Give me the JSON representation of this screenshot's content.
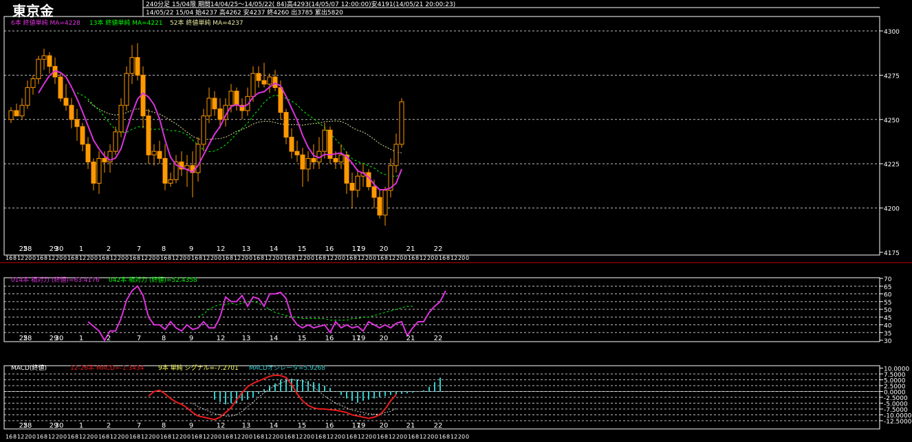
{
  "header": {
    "title": "東京金",
    "info_line1": "240分足  15/04限  期間14/04/25～14/05/22( 84)高4293(14/05/07 12:00:00)安4191(14/05/21 20:00:23)",
    "info_line2": "14/05/22 15/04  始4237 高4262 安4237 終4260 出3785 累出5820"
  },
  "colors": {
    "candle": "#ff9900",
    "ma6": "#dd33dd",
    "ma13": "#00ff00",
    "ma52": "#e6e6a0",
    "grid": "#ffffff",
    "frame": "#ffffff",
    "separator": "#cc0000",
    "macd_line": "#ee1c1c",
    "signal": "#ffffff",
    "histogram": "#33cccc"
  },
  "chart_data": [
    {
      "type": "candlestick",
      "legend": [
        {
          "label": "6本  終値単純  MA=4228",
          "color": "#dd33dd"
        },
        {
          "label": "13本  終値単純  MA=4221",
          "color": "#00ff00"
        },
        {
          "label": "52本  終値単純  MA=4237",
          "color": "#e6e6a0"
        }
      ],
      "y_ticks": [
        "4300",
        "4275",
        "4250",
        "4225",
        "4200",
        "4175"
      ],
      "ylim": [
        4175,
        4310
      ],
      "date_labels": [
        "28",
        "30",
        "1",
        "2",
        "7",
        "8",
        "9",
        "12",
        "13",
        "14",
        "15",
        "16",
        "19",
        "20",
        "21",
        "22"
      ],
      "date_labels_secondary": [
        "25",
        "29",
        "17"
      ],
      "hour_labels": [
        "16",
        "8",
        "12",
        "20",
        "0"
      ],
      "candles": [
        [
          4250,
          4257,
          4248,
          4255
        ],
        [
          4255,
          4259,
          4253,
          4252
        ],
        [
          4252,
          4262,
          4250,
          4258
        ],
        [
          4258,
          4272,
          4256,
          4268
        ],
        [
          4268,
          4275,
          4264,
          4273
        ],
        [
          4273,
          4286,
          4270,
          4284
        ],
        [
          4284,
          4290,
          4278,
          4286
        ],
        [
          4286,
          4288,
          4276,
          4280
        ],
        [
          4280,
          4285,
          4270,
          4274
        ],
        [
          4274,
          4276,
          4260,
          4262
        ],
        [
          4262,
          4270,
          4255,
          4258
        ],
        [
          4258,
          4262,
          4245,
          4250
        ],
        [
          4250,
          4256,
          4238,
          4246
        ],
        [
          4246,
          4248,
          4232,
          4236
        ],
        [
          4236,
          4240,
          4222,
          4226
        ],
        [
          4226,
          4228,
          4210,
          4214
        ],
        [
          4214,
          4232,
          4208,
          4228
        ],
        [
          4228,
          4232,
          4220,
          4226
        ],
        [
          4226,
          4236,
          4220,
          4232
        ],
        [
          4232,
          4246,
          4230,
          4243
        ],
        [
          4243,
          4262,
          4240,
          4258
        ],
        [
          4258,
          4280,
          4255,
          4276
        ],
        [
          4276,
          4292,
          4270,
          4285
        ],
        [
          4285,
          4293,
          4272,
          4275
        ],
        [
          4275,
          4280,
          4245,
          4252
        ],
        [
          4252,
          4256,
          4225,
          4230
        ],
        [
          4230,
          4236,
          4224,
          4232
        ],
        [
          4232,
          4238,
          4225,
          4228
        ],
        [
          4228,
          4236,
          4210,
          4214
        ],
        [
          4214,
          4220,
          4212,
          4216
        ],
        [
          4216,
          4230,
          4214,
          4226
        ],
        [
          4226,
          4232,
          4218,
          4222
        ],
        [
          4222,
          4230,
          4212,
          4224
        ],
        [
          4224,
          4232,
          4206,
          4220
        ],
        [
          4220,
          4240,
          4215,
          4236
        ],
        [
          4236,
          4256,
          4232,
          4252
        ],
        [
          4252,
          4268,
          4248,
          4262
        ],
        [
          4262,
          4266,
          4252,
          4256
        ],
        [
          4256,
          4262,
          4245,
          4250
        ],
        [
          4250,
          4262,
          4246,
          4258
        ],
        [
          4258,
          4270,
          4254,
          4266
        ],
        [
          4266,
          4268,
          4255,
          4258
        ],
        [
          4258,
          4262,
          4250,
          4255
        ],
        [
          4255,
          4268,
          4252,
          4263
        ],
        [
          4263,
          4280,
          4260,
          4276
        ],
        [
          4276,
          4280,
          4268,
          4272
        ],
        [
          4272,
          4282,
          4268,
          4270
        ],
        [
          4270,
          4276,
          4265,
          4274
        ],
        [
          4274,
          4278,
          4266,
          4268
        ],
        [
          4268,
          4272,
          4250,
          4254
        ],
        [
          4254,
          4256,
          4236,
          4240
        ],
        [
          4240,
          4245,
          4228,
          4232
        ],
        [
          4232,
          4238,
          4226,
          4230
        ],
        [
          4230,
          4234,
          4212,
          4222
        ],
        [
          4222,
          4232,
          4215,
          4228
        ],
        [
          4228,
          4236,
          4222,
          4226
        ],
        [
          4226,
          4240,
          4222,
          4232
        ],
        [
          4232,
          4248,
          4228,
          4244
        ],
        [
          4244,
          4246,
          4225,
          4228
        ],
        [
          4228,
          4232,
          4222,
          4226
        ],
        [
          4226,
          4236,
          4222,
          4230
        ],
        [
          4230,
          4232,
          4208,
          4214
        ],
        [
          4214,
          4220,
          4200,
          4210
        ],
        [
          4210,
          4222,
          4206,
          4218
        ],
        [
          4218,
          4225,
          4212,
          4220
        ],
        [
          4220,
          4222,
          4210,
          4212
        ],
        [
          4212,
          4216,
          4200,
          4206
        ],
        [
          4206,
          4210,
          4194,
          4196
        ],
        [
          4196,
          4212,
          4190,
          4210
        ],
        [
          4210,
          4228,
          4206,
          4224
        ],
        [
          4224,
          4242,
          4220,
          4236
        ],
        [
          4236,
          4262,
          4234,
          4260
        ]
      ]
    },
    {
      "type": "line",
      "legend": [
        {
          "label": "014本  相対力  (終値)=63.4176",
          "color": "#dd33dd"
        },
        {
          "label": "042本  相対力  (終値)=52.4358",
          "color": "#00ff00"
        }
      ],
      "y_ticks": [
        "70",
        "65",
        "60",
        "55",
        "50",
        "45",
        "40",
        "35",
        "30"
      ],
      "ylim": [
        30,
        70
      ],
      "rsi14_start_index": 14,
      "rsi14": [
        42,
        39,
        36,
        30,
        36,
        36,
        44,
        56,
        62,
        65,
        59,
        45,
        40,
        40,
        37,
        42,
        38,
        36,
        40,
        37,
        38,
        42,
        38,
        38,
        45,
        58,
        55,
        55,
        59,
        52,
        58,
        57,
        52,
        60,
        60,
        61,
        57,
        45,
        40,
        38,
        40,
        38,
        39,
        40,
        35,
        42,
        38,
        40,
        38,
        39,
        36,
        42,
        40,
        38,
        40,
        38,
        41,
        42,
        33,
        38,
        42,
        42,
        48,
        52,
        55,
        62
      ],
      "rsi42_start_index": 34,
      "rsi42": [
        45,
        47,
        50,
        52,
        53,
        53,
        54,
        53,
        54,
        55,
        55,
        54,
        52,
        50,
        48,
        47,
        46,
        45,
        45,
        44,
        44,
        44,
        44,
        44,
        43,
        43,
        43,
        43,
        44,
        44,
        45,
        45,
        46,
        47,
        48,
        49,
        50,
        51,
        52,
        52
      ]
    },
    {
      "type": "bar_line",
      "legend": [
        {
          "label": "MACD(終値)",
          "color": "#ffffff"
        },
        {
          "label": "12-26本  MACD=-1.3434",
          "color": "#ee1c1c"
        },
        {
          "label": "9本  単純  シグナル=-7.2701",
          "color": "#ffff66"
        },
        {
          "label": "MACDオシレータ=5.9268",
          "color": "#33cccc"
        }
      ],
      "y_ticks": [
        "10.0000",
        "7.5000",
        "5.0000",
        "2.5000",
        "0.0000",
        "-2.5000",
        "-5.0000",
        "-7.5000",
        "-10.0000",
        "-12.5000"
      ],
      "ylim": [
        -13.5,
        10
      ],
      "macd_start_index": 25,
      "macd": [
        -2,
        0,
        0.5,
        -1,
        -3,
        -4.5,
        -5.5,
        -7,
        -9,
        -10.5,
        -11,
        -11.5,
        -12,
        -11,
        -9,
        -7,
        -3.5,
        -0.5,
        2,
        3.5,
        4.5,
        5.5,
        6.5,
        7,
        6.8,
        6,
        3,
        -1,
        -4,
        -6,
        -7,
        -7.5,
        -7.5,
        -7.8,
        -8,
        -8.5,
        -9,
        -10,
        -10.5,
        -11,
        -11.5,
        -11,
        -10,
        -7.5,
        -4,
        -1.3434
      ],
      "signal_start_index": 33,
      "signal": [
        -5,
        -6.5,
        -7.5,
        -8.5,
        -9.5,
        -10,
        -10.5,
        -10.5,
        -10,
        -8.5,
        -6.5,
        -4.5,
        -2.5,
        -0.5,
        1,
        2.5,
        3.5,
        4.5,
        5,
        4.8,
        4.5,
        3.5,
        2,
        0,
        -2,
        -3.5,
        -5,
        -6,
        -7,
        -8,
        -8.5,
        -9,
        -9.5,
        -9.7,
        -9.7,
        -9,
        -8.5,
        -7.2701
      ],
      "histogram_start_index": 37,
      "histogram": [
        -3.5,
        -4.5,
        -5.5,
        -5,
        -5,
        -4,
        -3.5,
        -2.5,
        -1,
        1,
        2.5,
        3.5,
        5,
        5.5,
        5.5,
        5.2,
        5,
        4.5,
        4,
        3.5,
        2.5,
        1.5,
        0,
        -1.5,
        -3,
        -4,
        -4.8,
        -4,
        -3.5,
        -3,
        -2.5,
        -2,
        -1.5,
        -1.2,
        -1,
        -0.8,
        -0.5,
        -0.2,
        0.5,
        2,
        4,
        5.9268
      ]
    }
  ]
}
